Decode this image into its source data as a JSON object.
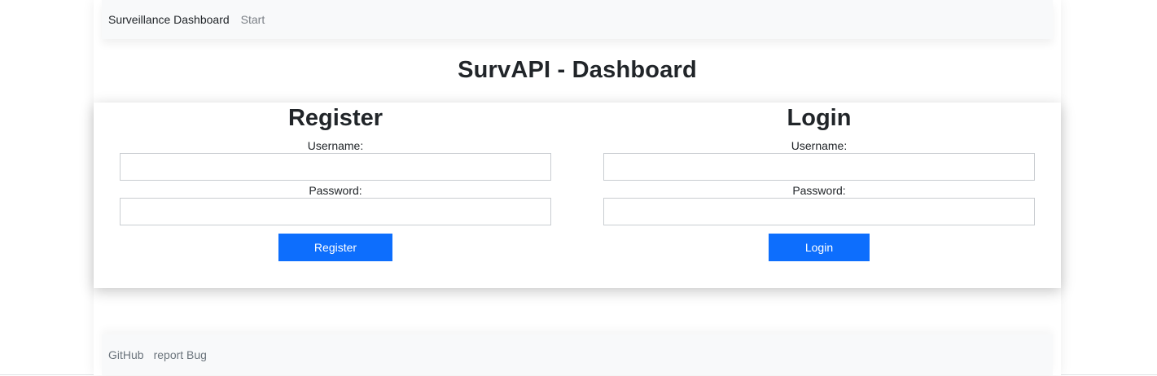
{
  "navbar": {
    "brand": "Surveillance Dashboard",
    "links": [
      "Start"
    ]
  },
  "page_title": "SurvAPI - Dashboard",
  "register": {
    "title": "Register",
    "username_label": "Username:",
    "username_value": "",
    "password_label": "Password:",
    "password_value": "",
    "button_label": "Register"
  },
  "login": {
    "title": "Login",
    "username_label": "Username:",
    "username_value": "",
    "password_label": "Password:",
    "password_value": "",
    "button_label": "Login"
  },
  "footer": {
    "links": [
      "GitHub",
      "report Bug"
    ]
  },
  "colors": {
    "primary": "#0d6efd",
    "navbar_bg": "#f8f9fa",
    "text": "#212529",
    "muted": "#6c757d"
  }
}
